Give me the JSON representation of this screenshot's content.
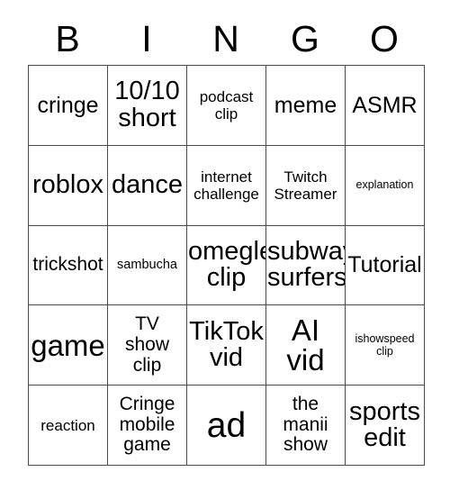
{
  "card": {
    "title": "BINGO",
    "header_letters": [
      "B",
      "I",
      "N",
      "G",
      "O"
    ],
    "grid_size": "5x5",
    "colors": {
      "border": "#4a4a4a",
      "text": "#000000",
      "background": "#ffffff"
    },
    "rows": [
      [
        {
          "label": "cringe",
          "size": "s-xl"
        },
        {
          "label": "10/10\nshort",
          "size": "s-2xl"
        },
        {
          "label": "podcast\nclip",
          "size": "s-md"
        },
        {
          "label": "meme",
          "size": "s-xl"
        },
        {
          "label": "ASMR",
          "size": "s-xl"
        }
      ],
      [
        {
          "label": "roblox",
          "size": "s-2xl"
        },
        {
          "label": "dance",
          "size": "s-2xl"
        },
        {
          "label": "internet\nchallenge",
          "size": "s-md"
        },
        {
          "label": "Twitch\nStreamer",
          "size": "s-md"
        },
        {
          "label": "explanation",
          "size": "s-xs"
        }
      ],
      [
        {
          "label": "trickshot",
          "size": "s-lg"
        },
        {
          "label": "sambucha",
          "size": "s-sm"
        },
        {
          "label": "omegle\nclip",
          "size": "s-2xl"
        },
        {
          "label": "subway\nsurfers",
          "size": "s-2xl"
        },
        {
          "label": "Tutorial",
          "size": "s-xl"
        }
      ],
      [
        {
          "label": "game",
          "size": "s-3xl"
        },
        {
          "label": "TV\nshow\nclip",
          "size": "s-lg"
        },
        {
          "label": "TikTok\nvid",
          "size": "s-2xl"
        },
        {
          "label": "AI\nvid",
          "size": "s-3xl"
        },
        {
          "label": "ishowspeed\nclip",
          "size": "s-xs"
        }
      ],
      [
        {
          "label": "reaction",
          "size": "s-md"
        },
        {
          "label": "Cringe\nmobile\ngame",
          "size": "s-lg"
        },
        {
          "label": "ad",
          "size": "s-4xl"
        },
        {
          "label": "the\nmanii\nshow",
          "size": "s-lg"
        },
        {
          "label": "sports\nedit",
          "size": "s-2xl"
        }
      ]
    ]
  }
}
